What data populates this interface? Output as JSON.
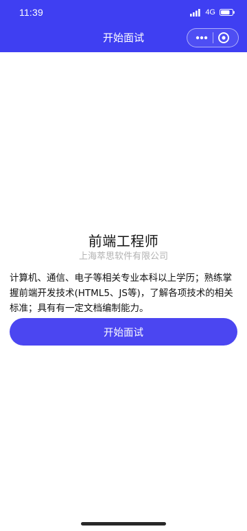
{
  "status_bar": {
    "time": "11:39",
    "network": "4G",
    "signal_icon": "signal-icon",
    "battery_icon": "battery-icon"
  },
  "nav": {
    "title": "开始面试",
    "more_icon": "more-dots-icon",
    "close_icon": "target-circle-icon",
    "brand_color": "#3f3ff2"
  },
  "job": {
    "title": "前端工程师",
    "company": "上海萃思软件有限公司",
    "description": "计算机、通信、电子等相关专业本科以上学历；熟练掌握前端开发技术(HTML5、JS等)，了解各项技术的相关标准；具有有一定文档编制能力。"
  },
  "actions": {
    "start_button_label": "开始面试",
    "start_button_color": "#4b46f1"
  }
}
